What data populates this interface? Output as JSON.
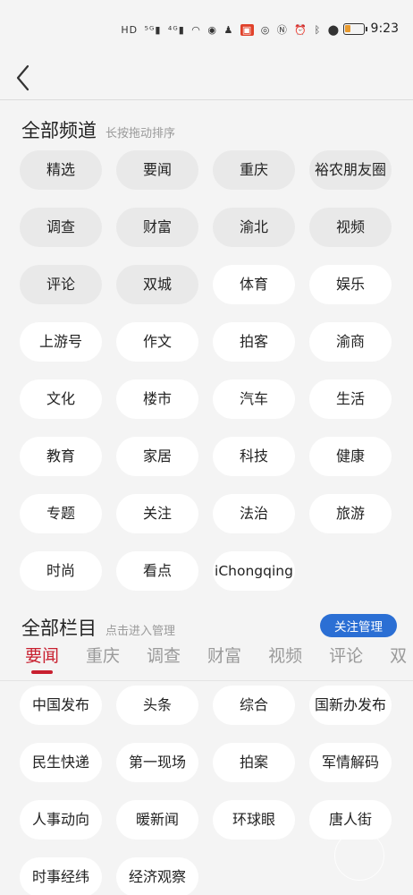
{
  "status_bar": {
    "indicators": [
      "HD",
      "5G",
      "4G",
      "wifi",
      "app",
      "qq",
      "app2",
      "eye",
      "nfc",
      "alarm",
      "bluetooth",
      "location"
    ],
    "time": "9:23",
    "battery_color": "#e89a2e"
  },
  "header": {
    "back_icon": "chevron-left-icon"
  },
  "all_channels": {
    "title": "全部频道",
    "hint": "长按拖动排序",
    "fixed_items": [
      "精选",
      "要闻",
      "重庆",
      "裕农朋友圈",
      "调查",
      "财富",
      "渝北",
      "视频",
      "评论",
      "双城"
    ],
    "items": [
      "精选",
      "要闻",
      "重庆",
      "裕农朋友圈",
      "调查",
      "财富",
      "渝北",
      "视频",
      "评论",
      "双城",
      "体育",
      "娱乐",
      "上游号",
      "作文",
      "拍客",
      "渝商",
      "文化",
      "楼市",
      "汽车",
      "生活",
      "教育",
      "家居",
      "科技",
      "健康",
      "专题",
      "关注",
      "法治",
      "旅游",
      "时尚",
      "看点",
      "iChongqing"
    ]
  },
  "all_columns": {
    "title": "全部栏目",
    "hint": "点击进入管理",
    "manage_label": "关注管理",
    "manage_color": "#2b6fd4",
    "tabs": [
      "要闻",
      "重庆",
      "调查",
      "财富",
      "视频",
      "评论",
      "双"
    ],
    "active_tab": "要闻",
    "accent_color": "#c81f2f",
    "items": [
      "中国发布",
      "头条",
      "综合",
      "国新办发布",
      "民生快递",
      "第一现场",
      "拍案",
      "军情解码",
      "人事动向",
      "暖新闻",
      "环球眼",
      "唐人街",
      "时事经纬",
      "经济观察"
    ]
  }
}
